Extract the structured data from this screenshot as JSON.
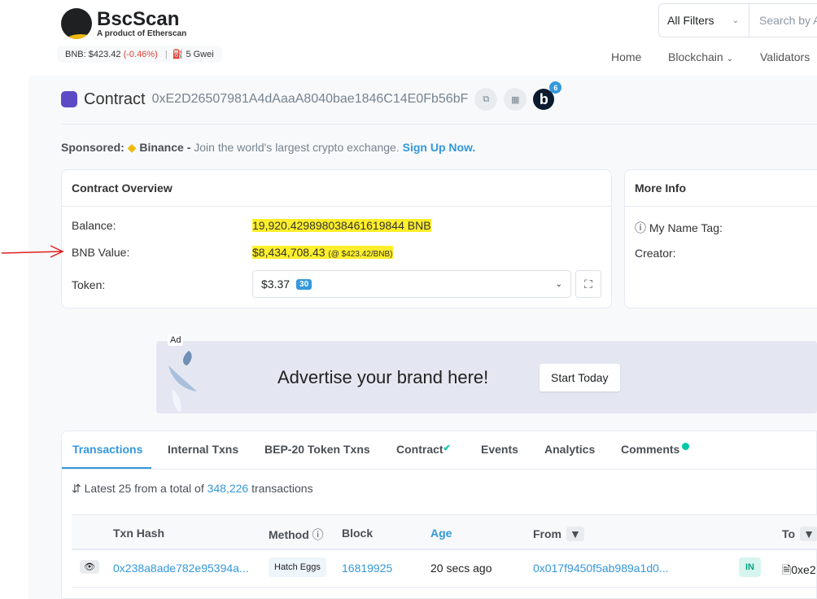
{
  "header": {
    "brand": "BscScan",
    "tagline": "A product of Etherscan",
    "bnb_price": "BNB: $423.42",
    "bnb_change": "(-0.46%)",
    "gas": "5 Gwei",
    "filter": "All Filters",
    "search_placeholder": "Search by Address",
    "nav": [
      "Home",
      "Blockchain",
      "Validators"
    ]
  },
  "contract": {
    "label": "Contract",
    "address": "0xE2D26507981A4dAaaA8040bae1846C14E0Fb56bF",
    "badge_letter": "b",
    "badge_count": "6"
  },
  "sponsored": {
    "label": "Sponsored:",
    "name": "Binance -",
    "text": "Join the world's largest crypto exchange.",
    "cta": "Sign Up Now."
  },
  "overview": {
    "title": "Contract Overview",
    "balance_label": "Balance:",
    "balance": "19,920.429898038461619844 BNB",
    "value_label": "BNB Value:",
    "value": "$8,434,708.43",
    "value_rate": "(@ $423.42/BNB)",
    "token_label": "Token:",
    "token_value": "$3.37",
    "token_count": "30"
  },
  "more_info": {
    "title": "More Info",
    "name_tag": "My Name Tag:",
    "creator": "Creator:"
  },
  "ad": {
    "tag": "Ad",
    "text": "Advertise your brand here!",
    "cta": "Start Today"
  },
  "tabs": [
    "Transactions",
    "Internal Txns",
    "BEP-20 Token Txns",
    "Contract",
    "Events",
    "Analytics",
    "Comments"
  ],
  "txns": {
    "summary_prefix": "Latest 25 from a total of",
    "total": "348,226",
    "summary_suffix": "transactions",
    "columns": [
      "Txn Hash",
      "Method",
      "Block",
      "Age",
      "From",
      "To"
    ],
    "rows": [
      {
        "hash": "0x238a8ade782e95394a...",
        "method": "Hatch Eggs",
        "block": "16819925",
        "age": "20 secs ago",
        "from": "0x017f9450f5ab989a1d0...",
        "dir": "IN",
        "to": "0xe2"
      }
    ]
  },
  "colors": {
    "accent": "#3498db",
    "highlight": "#ffef2a",
    "annotation_arrow": "#e02020"
  }
}
